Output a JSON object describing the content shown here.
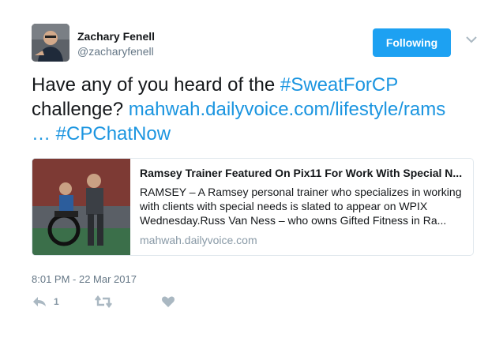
{
  "author": {
    "name": "Zachary Fenell",
    "handle": "@zacharyfenell"
  },
  "follow_button": {
    "label": "Following"
  },
  "tweet": {
    "text_plain_1": "Have any of you heard of the ",
    "hashtag_1": "#SweatForCP",
    "text_plain_2": " challenge? ",
    "url": "mahwah.dailyvoice.com/lifestyle/rams",
    "url_ellipsis": "…",
    "hashtag_2": "#CPChatNow"
  },
  "card": {
    "title": "Ramsey Trainer Featured On Pix11 For Work With Special N...",
    "description": "RAMSEY – A Ramsey personal trainer who specializes in working with clients with special needs is slated to appear on WPIX Wednesday.Russ Van Ness – who owns Gifted Fitness in Ra...",
    "domain": "mahwah.dailyvoice.com"
  },
  "timestamp": "8:01 PM - 22 Mar 2017",
  "actions": {
    "reply_count": "1"
  },
  "icons": {
    "caret": "chevron-down-icon",
    "reply": "reply-icon",
    "retweet": "retweet-icon",
    "like": "heart-icon"
  },
  "colors": {
    "accent": "#1da1f2",
    "link": "#1b95e0",
    "muted": "#657786",
    "action_icon": "#aab8c2"
  }
}
